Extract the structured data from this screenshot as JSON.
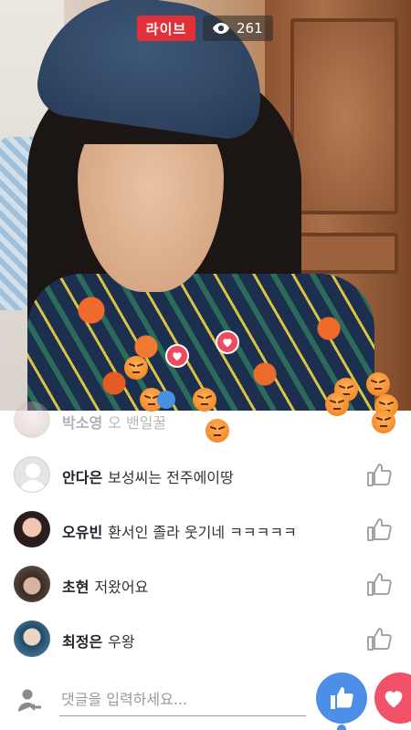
{
  "live_badge": "라이브",
  "viewer_count": "261",
  "comment_input": {
    "placeholder": "댓글을 입력하세요..."
  },
  "comments": [
    {
      "name": "박소영",
      "text": "오 밴일꿀",
      "avatar": "pink-photo"
    },
    {
      "name": "안다은",
      "text": "보성씨는 전주에이땅",
      "avatar": "default-silhouette"
    },
    {
      "name": "오유빈",
      "text": "환서인 졸라 웃기네 ㅋㅋㅋㅋㅋ",
      "avatar": "photo"
    },
    {
      "name": "초현",
      "text": "저왔어요",
      "avatar": "photo"
    },
    {
      "name": "최정은",
      "text": "우왕",
      "avatar": "photo"
    }
  ],
  "icons": {
    "viewers": "eye-icon",
    "comment_like": "thumbs-up-outline-icon",
    "user": "user-share-icon",
    "like_fab": "thumbs-up-icon",
    "love_fab": "heart-icon"
  },
  "colors": {
    "live_red": "#e0303a",
    "like_blue": "#4d8fe6",
    "love_red": "#f25268",
    "angry_orange": "#f48b2a"
  }
}
